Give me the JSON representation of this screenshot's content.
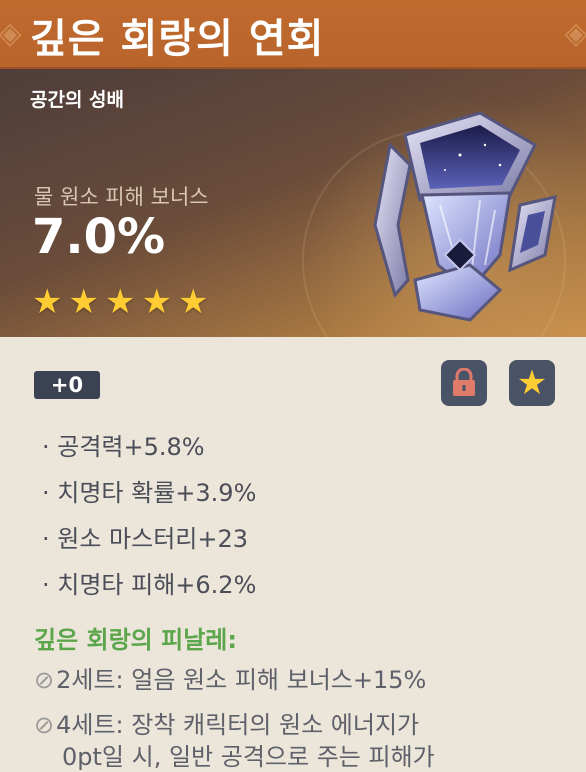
{
  "artifact": {
    "name": "깊은 회랑의 연회",
    "type": "공간의 성배",
    "main_stat_name": "물 원소 피해 보너스",
    "main_stat_value": "7.0%",
    "rarity_stars": 5,
    "level": "+0"
  },
  "substats": [
    "· 공격력+5.8%",
    "· 치명타 확률+3.9%",
    "· 원소 마스터리+23",
    "· 치명타 피해+6.2%"
  ],
  "set": {
    "name": "깊은 회랑의 피날레:",
    "bonuses": [
      {
        "icon": "⊘",
        "lines": [
          "2세트: 얼음 원소 피해 보너스+15%"
        ]
      },
      {
        "icon": "⊘",
        "lines": [
          "4세트: 장착 캐릭터의 원소 에너지가",
          "0pt일 시, 일반 공격으로 주는 피해가"
        ]
      }
    ]
  },
  "icons": {
    "lock": "lock-icon",
    "favorite": "star-icon"
  },
  "colors": {
    "header": "#b8642b",
    "star": "#ffcc33",
    "set_name": "#5ba64a",
    "lock": "#e07a6a"
  }
}
